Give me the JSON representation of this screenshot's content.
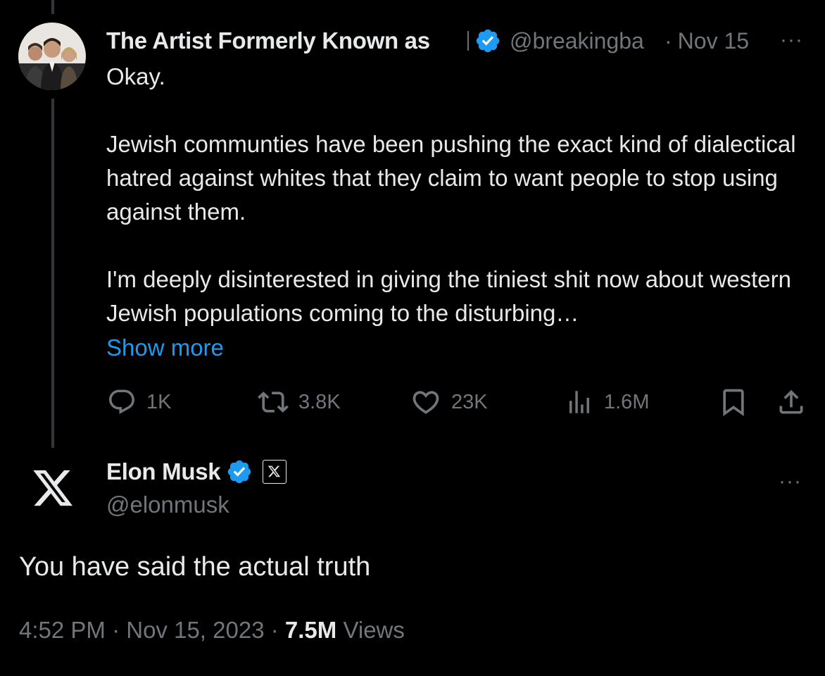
{
  "original_tweet": {
    "display_name": "The Artist Formerly Known as",
    "handle": "@breakingba",
    "separator": "·",
    "date": "Nov 15",
    "more": "···",
    "text": "Okay.\n\nJewish communties have been pushing the exact kind of dialectical hatred against whites that they claim to want people to stop using against them.\n\nI'm deeply disinterested in giving the tiniest shit now about western Jewish populations coming to the disturbing…",
    "show_more": "Show more",
    "actions": {
      "replies": "1K",
      "reposts": "3.8K",
      "likes": "23K",
      "views": "1.6M"
    }
  },
  "reply_tweet": {
    "display_name": "Elon Musk",
    "handle": "@elonmusk",
    "more": "···",
    "text": "You have said the actual truth",
    "time": "4:52 PM",
    "separator": "·",
    "date": "Nov 15, 2023",
    "views_count": "7.5M",
    "views_label": "Views"
  },
  "colors": {
    "background": "#000000",
    "primary_text": "#e7e9ea",
    "secondary_text": "#71767b",
    "accent": "#1d9bf0",
    "thread_line": "#333639"
  },
  "icons": {
    "verified": "verified-badge-icon",
    "reply": "reply-icon",
    "repost": "repost-icon",
    "like": "heart-icon",
    "views": "views-chart-icon",
    "bookmark": "bookmark-icon",
    "share": "share-icon",
    "x_logo": "x-logo-icon",
    "affiliate": "x-affiliate-badge-icon"
  }
}
